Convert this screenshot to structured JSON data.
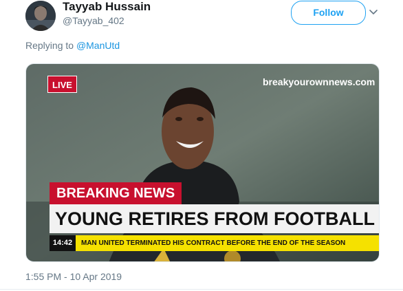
{
  "author": {
    "name": "Tayyab Hussain",
    "handle": "@Tayyab_402"
  },
  "follow_button": {
    "label": "Follow"
  },
  "reply": {
    "prefix": "Replying to",
    "mention": "@ManUtd"
  },
  "media": {
    "live_badge": "LIVE",
    "site_url": "breakyourownnews.com",
    "breaking_label": "BREAKING NEWS",
    "headline": "YOUNG RETIRES FROM FOOTBALL",
    "clock": "14:42",
    "ticker": "MAN UNITED TERMINATED HIS CONTRACT BEFORE THE END OF THE SEASON"
  },
  "timestamp": "1:55 PM - 10 Apr 2019",
  "colors": {
    "accent": "#1da1f2",
    "breaking_red": "#c8102e",
    "ticker_yellow": "#f5e100"
  },
  "icons": {
    "caret": "chevron-down-icon"
  }
}
